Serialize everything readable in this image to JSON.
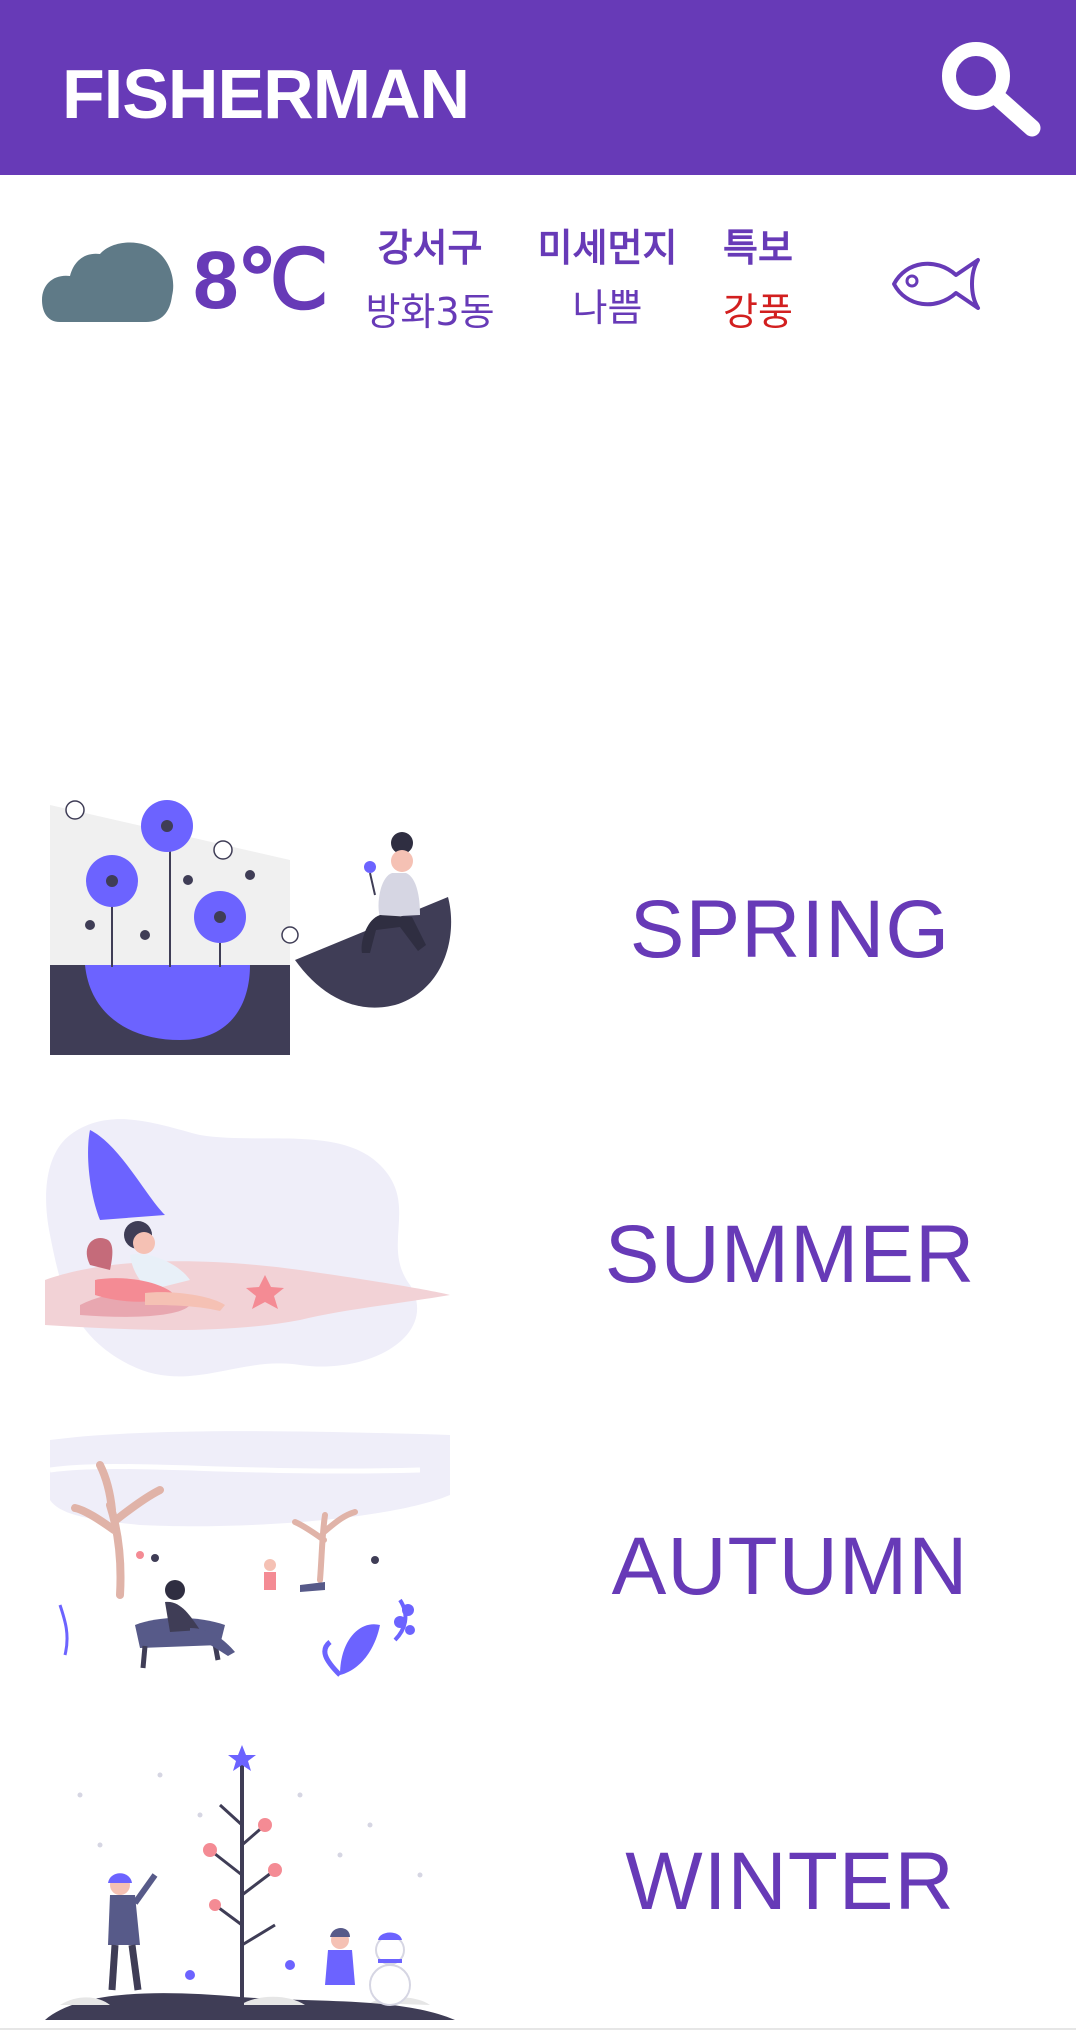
{
  "app": {
    "title": "FISHERMAN"
  },
  "header": {
    "search_icon": "search-icon"
  },
  "weather": {
    "icon": "cloud-icon",
    "temperature": "8℃",
    "location": {
      "district": "강서구",
      "dong": "방화3동"
    },
    "fine_dust": {
      "label": "미세먼지",
      "value": "나쁨"
    },
    "alert": {
      "label": "특보",
      "value": "강풍"
    },
    "fish_icon": "fish-icon"
  },
  "seasons": [
    {
      "label": "SPRING",
      "illustration": "spring-illustration"
    },
    {
      "label": "SUMMER",
      "illustration": "summer-illustration"
    },
    {
      "label": "AUTUMN",
      "illustration": "autumn-illustration"
    },
    {
      "label": "WINTER",
      "illustration": "winter-illustration"
    }
  ],
  "colors": {
    "primary": "#673ab7",
    "accent": "#6c63ff",
    "alert": "#d21f1f",
    "cloud": "#5f7a87"
  }
}
